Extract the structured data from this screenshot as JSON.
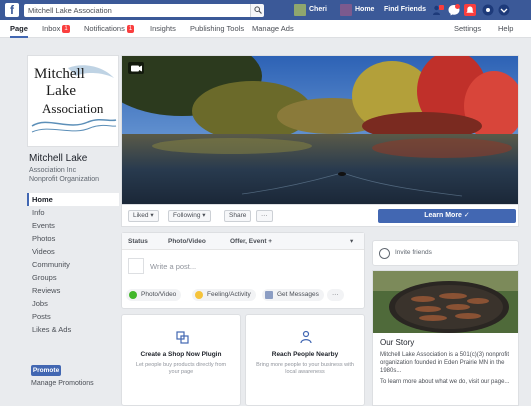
{
  "topbar": {
    "search_value": "Mitchell Lake Association",
    "user_name": "Cheri",
    "home_label": "Home",
    "find_friends_label": "Find Friends"
  },
  "tabs": [
    {
      "label": "Page",
      "active": true
    },
    {
      "label": "Inbox",
      "badge": "1"
    },
    {
      "label": "Notifications",
      "badge": "1"
    },
    {
      "label": "Insights"
    },
    {
      "label": "Publishing Tools"
    },
    {
      "label": "Manage Ads"
    },
    {
      "label": "Settings"
    },
    {
      "label": "Help"
    }
  ],
  "page": {
    "logo_text": [
      "Mitchell",
      "Lake",
      "Association"
    ],
    "name": "Mitchell Lake",
    "handle": "Association Inc",
    "category": "Nonprofit Organization"
  },
  "leftnav": [
    "Home",
    "Info",
    "Events",
    "Photos",
    "Videos",
    "Community",
    "Groups",
    "Reviews",
    "Jobs",
    "Posts",
    "Likes & Ads"
  ],
  "promote_label": "Promote",
  "manage_promotions_label": "Manage Promotions",
  "actions": {
    "liked": "Liked ▾",
    "following": "Following ▾",
    "share": "Share",
    "more": "···",
    "learn_more": "Learn More ✓"
  },
  "composer": {
    "tabs": [
      "Status",
      "Photo/Video",
      "Offer, Event +"
    ],
    "placeholder": "Write a post...",
    "options": [
      "Photo/Video",
      "Feeling/Activity",
      "Get Messages"
    ],
    "more": "···"
  },
  "cards": [
    {
      "title": "Create a Shop Now Plugin",
      "desc": "Let people buy products directly from your page"
    },
    {
      "title": "Reach People Nearby",
      "desc": "Bring more people to your business with local awareness"
    }
  ],
  "right": {
    "invite_label": "Invite friends",
    "story_title": "Our Story",
    "story_p1": "Mitchell Lake Association is a 501(c)(3) nonprofit organization founded in Eden Prairie MN in the 1980s...",
    "story_p2": "To learn more about what we do, visit our page..."
  },
  "colors": {
    "fb_blue": "#3b5998",
    "accent": "#4267b2",
    "badge_red": "#fa3e3e"
  }
}
